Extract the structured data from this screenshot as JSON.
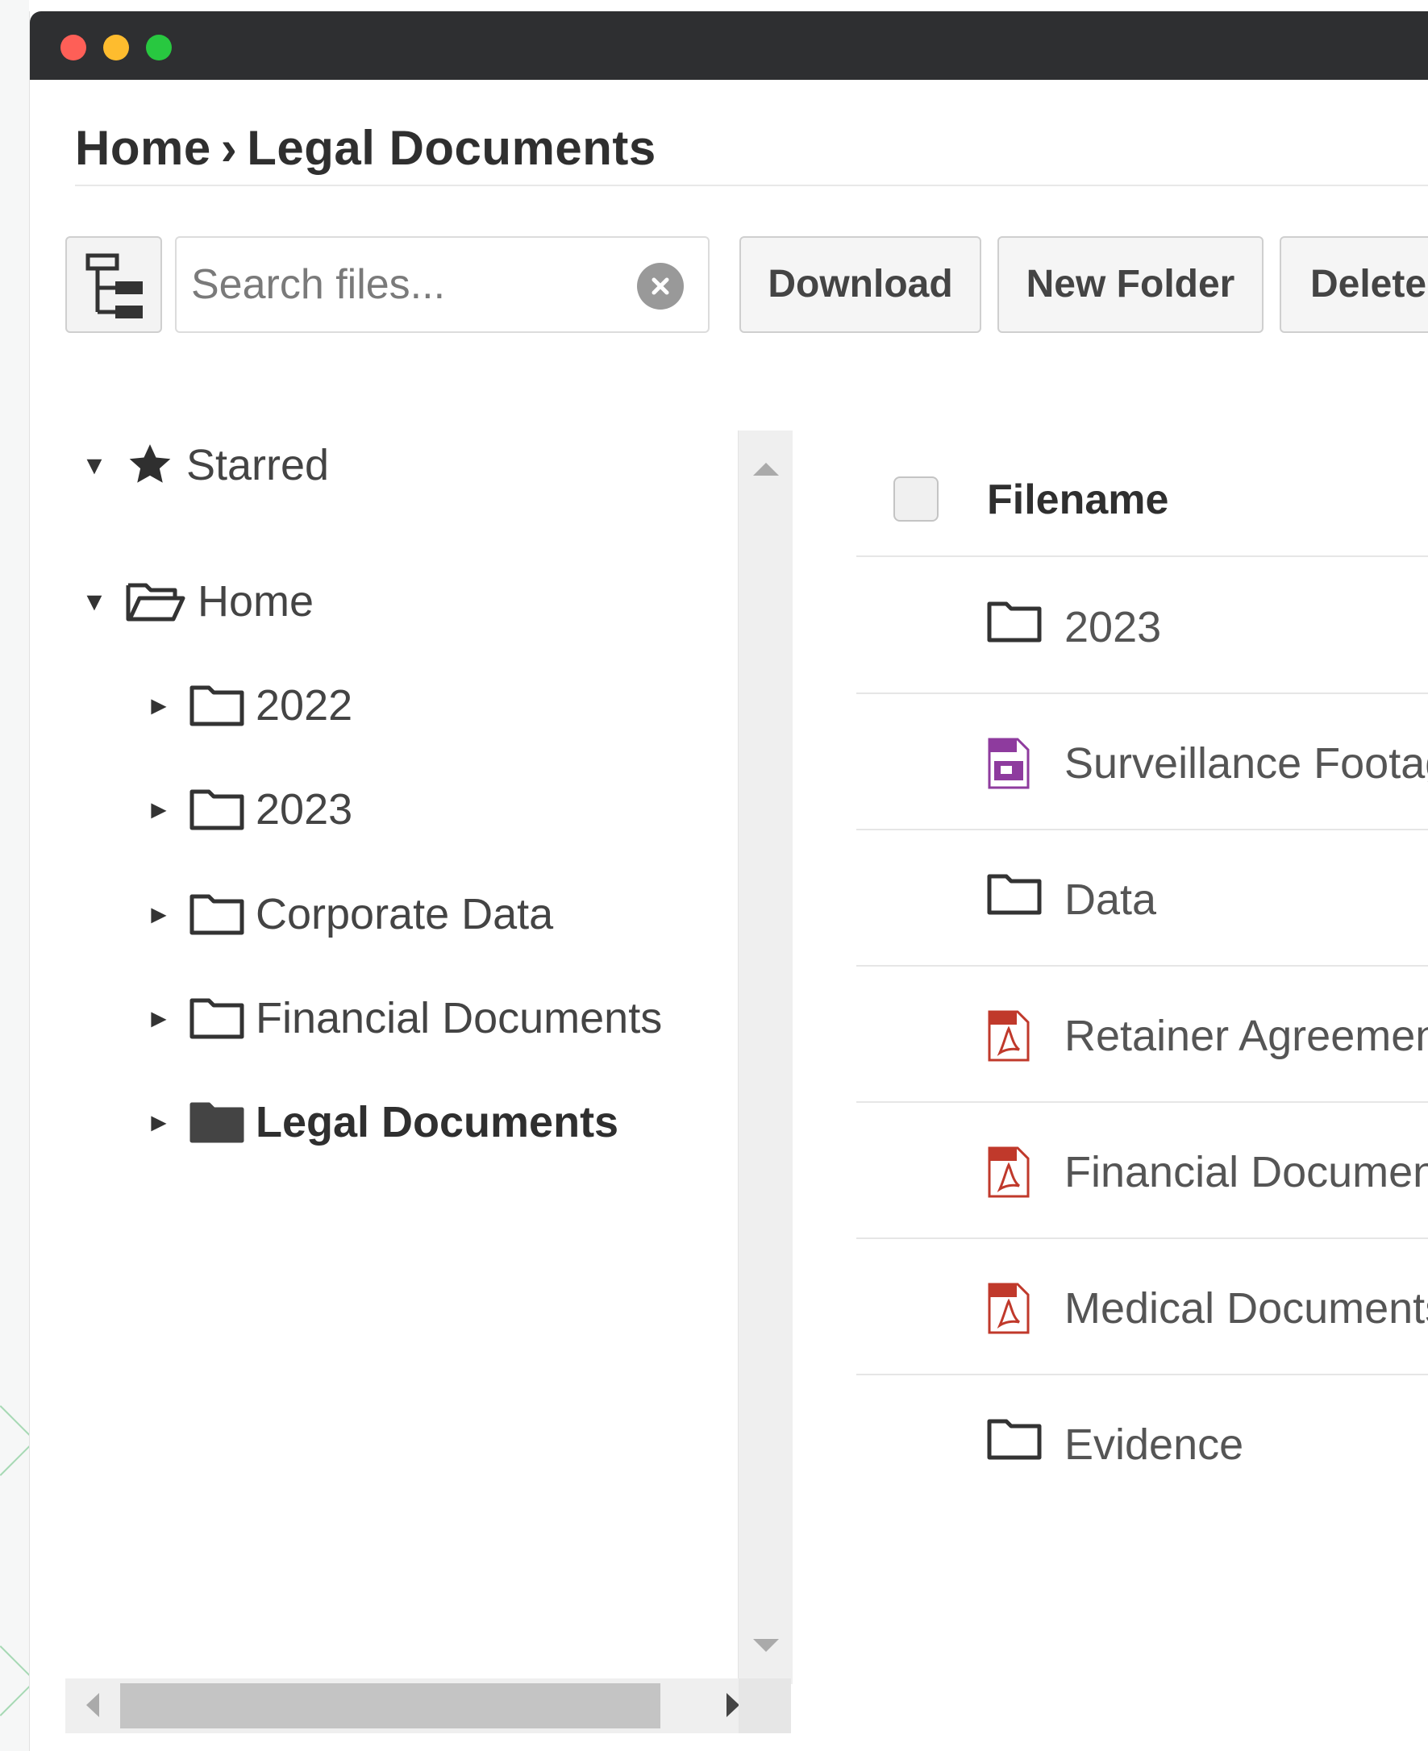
{
  "window": {
    "controls": [
      "close",
      "minimize",
      "maximize"
    ],
    "colors": {
      "titlebar": "#2e2f31",
      "close": "#fe5f57",
      "minimize": "#febc2e",
      "maximize": "#28c840"
    }
  },
  "breadcrumb": {
    "home": "Home",
    "separator": "›",
    "current": "Legal Documents"
  },
  "toolbar": {
    "tree_toggle_icon": "folder-tree-icon",
    "search_placeholder": "Search files...",
    "search_value": "",
    "clear_icon": "close-circle-icon",
    "download_label": "Download",
    "new_folder_label": "New Folder",
    "delete_label": "Delete"
  },
  "tree": {
    "starred": {
      "label": "Starred",
      "icon": "star-icon",
      "expanded": true
    },
    "home": {
      "label": "Home",
      "icon": "folder-open-icon",
      "expanded": true
    },
    "children": [
      {
        "label": "2022",
        "icon": "folder-icon",
        "selected": false
      },
      {
        "label": "2023",
        "icon": "folder-icon",
        "selected": false
      },
      {
        "label": "Corporate Data",
        "icon": "folder-icon",
        "selected": false
      },
      {
        "label": "Financial Documents",
        "icon": "folder-icon",
        "selected": false
      },
      {
        "label": "Legal Documents",
        "icon": "folder-filled-icon",
        "selected": true
      }
    ]
  },
  "files": {
    "header": {
      "filename": "Filename"
    },
    "rows": [
      {
        "name": "2023",
        "icon": "folder-icon",
        "type": "folder"
      },
      {
        "name": "Surveillance Footag",
        "icon": "video-file-icon",
        "type": "video"
      },
      {
        "name": "Data",
        "icon": "folder-icon",
        "type": "folder"
      },
      {
        "name": "Retainer Agreemen",
        "icon": "pdf-file-icon",
        "type": "pdf"
      },
      {
        "name": "Financial Documen",
        "icon": "pdf-file-icon",
        "type": "pdf"
      },
      {
        "name": "Medical Documents",
        "icon": "pdf-file-icon",
        "type": "pdf"
      },
      {
        "name": "Evidence",
        "icon": "folder-icon",
        "type": "folder"
      }
    ]
  }
}
